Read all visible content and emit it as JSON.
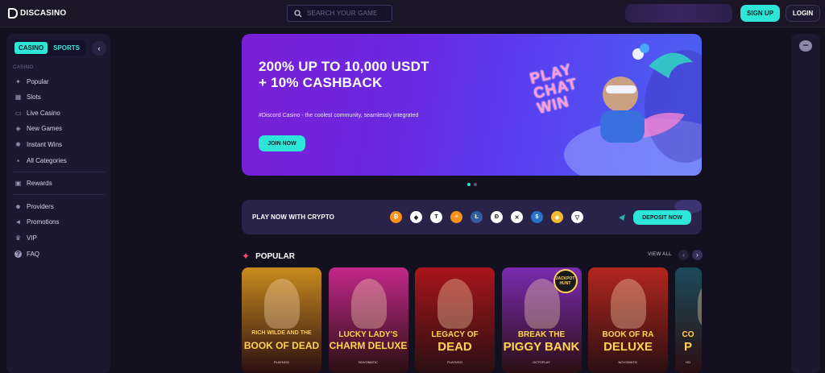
{
  "header": {
    "logo_text": "DISCASINO",
    "search_placeholder": "SEARCH YOUR GAME",
    "signup_label": "SIGN UP",
    "login_label": "LOGIN"
  },
  "sidebar": {
    "tabs": [
      {
        "label": "CASINO",
        "active": true
      },
      {
        "label": "SPORTS",
        "active": false
      }
    ],
    "section_label": "CASINO",
    "items": [
      {
        "label": "Popular",
        "icon": "popular-icon"
      },
      {
        "label": "Slots",
        "icon": "slots-icon"
      },
      {
        "label": "Live Casino",
        "icon": "live-casino-icon"
      },
      {
        "label": "New Games",
        "icon": "new-games-icon"
      },
      {
        "label": "Instant Wins",
        "icon": "instant-wins-icon"
      },
      {
        "label": "All Categories",
        "icon": "grid-icon"
      },
      {
        "label": "Rewards",
        "icon": "gift-icon"
      },
      {
        "label": "Providers",
        "icon": "providers-icon"
      },
      {
        "label": "Promotions",
        "icon": "megaphone-icon"
      },
      {
        "label": "VIP",
        "icon": "crown-icon"
      },
      {
        "label": "FAQ",
        "icon": "question-icon"
      }
    ]
  },
  "hero": {
    "title": "200% UP TO 10,000 USDT + 10% CASHBACK",
    "subtitle": "#Discord Casino - the coolest community, seamlessly integrated",
    "button_label": "JOIN NOW",
    "art_text": [
      "PLAY",
      "CHAT",
      "WIN"
    ],
    "slides": 2,
    "active_slide": 1
  },
  "crypto_bar": {
    "label": "PLAY NOW WITH CRYPTO",
    "coins": [
      {
        "name": "bitcoin",
        "color": "#f7931a",
        "glyph": "₿"
      },
      {
        "name": "ethereum",
        "color": "#ffffff",
        "glyph": "◆"
      },
      {
        "name": "tether",
        "color": "#ffffff",
        "glyph": "T"
      },
      {
        "name": "bitcoin-cash",
        "color": "#f7931a",
        "glyph": "≡"
      },
      {
        "name": "litecoin",
        "color": "#345d9d",
        "glyph": "Ł"
      },
      {
        "name": "dogecoin",
        "color": "#ffffff",
        "glyph": "Ð"
      },
      {
        "name": "ripple",
        "color": "#ffffff",
        "glyph": "✕"
      },
      {
        "name": "usd-coin",
        "color": "#2775ca",
        "glyph": "$"
      },
      {
        "name": "binance",
        "color": "#f3ba2f",
        "glyph": "◈"
      },
      {
        "name": "tron",
        "color": "#ffffff",
        "glyph": "▽"
      }
    ],
    "button_label": "DEPOSIT NOW"
  },
  "popular": {
    "title": "POPULAR",
    "view_all_label": "VIEW ALL",
    "games": [
      {
        "title_line1": "RICH WILDE AND THE",
        "title_line2": "BOOK OF DEAD",
        "provider": "PLAYNGO",
        "bg": "#c98a1e"
      },
      {
        "title_line1": "LUCKY LADY'S",
        "title_line2": "CHARM DELUXE",
        "provider": "NOVOMATIC",
        "bg": "#c2288a"
      },
      {
        "title_line1": "LEGACY OF",
        "title_line2": "DEAD",
        "provider": "PLAYNGO",
        "bg": "#a8151b"
      },
      {
        "title_line1": "BREAK THE",
        "title_line2": "PIGGY BANK",
        "provider": "OCTOPLAY",
        "bg": "#7a2bb0",
        "badge": "JACKPOT HUNT"
      },
      {
        "title_line1": "BOOK OF RA",
        "title_line2": "DELUXE",
        "provider": "NOVOMATIC",
        "bg": "#b3261e"
      },
      {
        "title_line1": "CO",
        "title_line2": "P",
        "provider": "HO",
        "bg": "#1d4a5a"
      }
    ]
  }
}
